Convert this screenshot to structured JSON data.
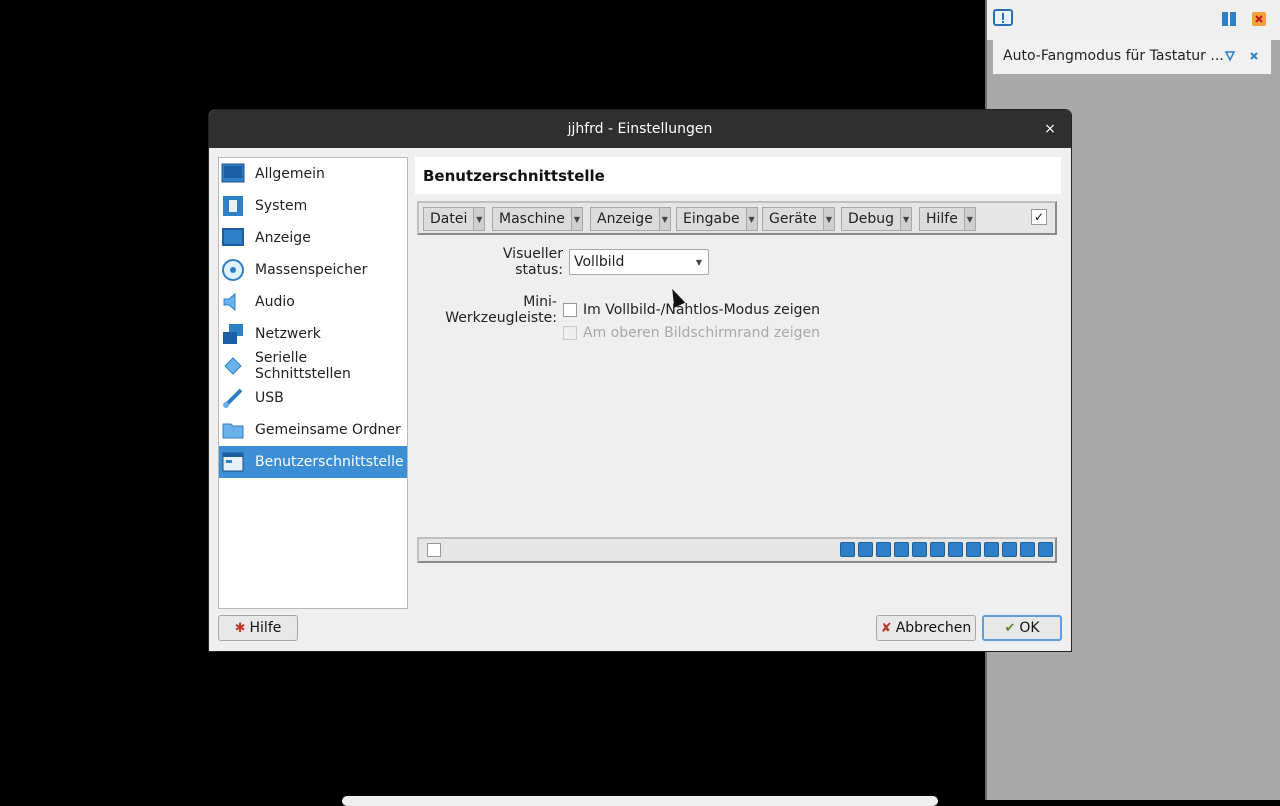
{
  "side_panel": {
    "notification_text": "Auto-Fangmodus für Tastatur ..."
  },
  "dialog": {
    "title": "jjhfrd - Einstellungen",
    "close_glyph": "×",
    "nav_items": [
      {
        "label": "Allgemein",
        "icon": "general-icon"
      },
      {
        "label": "System",
        "icon": "system-icon"
      },
      {
        "label": "Anzeige",
        "icon": "display-icon"
      },
      {
        "label": "Massenspeicher",
        "icon": "storage-icon"
      },
      {
        "label": "Audio",
        "icon": "audio-icon"
      },
      {
        "label": "Netzwerk",
        "icon": "network-icon"
      },
      {
        "label": "Serielle Schnittstellen",
        "icon": "serial-ports-icon"
      },
      {
        "label": "USB",
        "icon": "usb-icon"
      },
      {
        "label": "Gemeinsame Ordner",
        "icon": "shared-folders-icon"
      },
      {
        "label": "Benutzerschnittstelle",
        "icon": "user-interface-icon",
        "active": true
      }
    ],
    "section_title": "Benutzerschnittstelle",
    "menubar_items": [
      "Datei",
      "Maschine",
      "Anzeige",
      "Eingabe",
      "Geräte",
      "Debug",
      "Hilfe"
    ],
    "menubar_enabled_check": "✓",
    "visual_state_label": "Visueller status:",
    "visual_state_value": "Vollbild",
    "mini_toolbar_label": "Mini-Werkzeugleiste:",
    "mini_toolbar_option1": "Im Vollbild-/Nahtlos-Modus zeigen",
    "mini_toolbar_option2": "Am oberen Bildschirmrand zeigen",
    "buttons": {
      "help": "Hilfe",
      "cancel": "Abbrechen",
      "ok": "OK"
    }
  },
  "colors": {
    "accent": "#3c8ed5",
    "titlebar": "#2f2f2f",
    "dialog_bg": "#efefef"
  }
}
